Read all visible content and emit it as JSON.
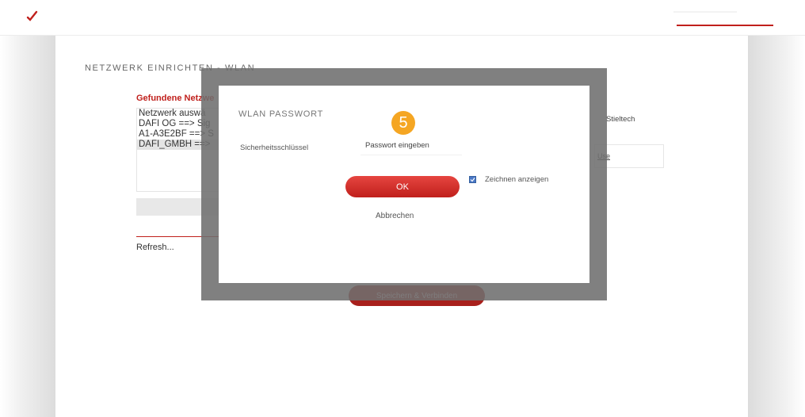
{
  "header": {
    "logo_icon": "checkmark-swoosh-logo",
    "accent_color": "#c0201c"
  },
  "page": {
    "title": "NETZWERK EINRICHTEN - WLAN",
    "found_networks_label": "Gefundene Netzwe",
    "network_list": [
      "Netzwerk auswä",
      "DAFI OG ==> Sig",
      "A1-A3E2BF ==> S",
      "DAFI_GMBH ==>"
    ],
    "selected_network_index": 3,
    "refresh": "Refresh...",
    "right_label": "Stieltech",
    "right_input_text": "Use",
    "save_connect": "Speichern & Verbinden"
  },
  "modal": {
    "title": "WLAN PASSWORT",
    "step_badge": "5",
    "step_badge_color": "#f5a623",
    "key_label": "Sicherheitsschlüssel",
    "password_placeholder": "Passwort eingeben",
    "password_value": "",
    "ok": "OK",
    "show_chars_label": "Zeichnen anzeigen",
    "show_chars_checked": true,
    "cancel": "Abbrechen"
  }
}
